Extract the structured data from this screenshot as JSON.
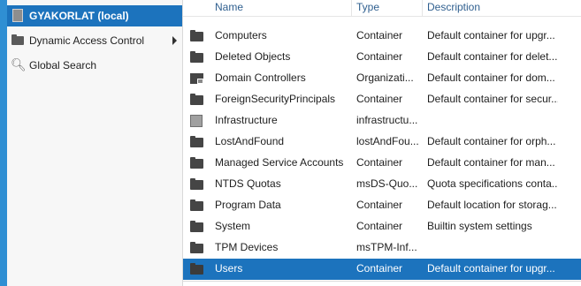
{
  "nav": {
    "items": [
      {
        "label": "GYAKORLAT (local)",
        "icon": "server-icon",
        "selected": true,
        "has_arrow": true
      },
      {
        "label": "Dynamic Access Control",
        "icon": "folder-icon",
        "selected": false,
        "has_arrow": true
      },
      {
        "label": "Global Search",
        "icon": "search-icon",
        "selected": false,
        "has_arrow": false
      }
    ]
  },
  "list": {
    "columns": [
      "Name",
      "Type",
      "Description"
    ],
    "rows": [
      {
        "name": "Computers",
        "type": "Container",
        "description": "Default container for upgr...",
        "icon": "folder-icon"
      },
      {
        "name": "Deleted Objects",
        "type": "Container",
        "description": "Default container for delet...",
        "icon": "folder-icon"
      },
      {
        "name": "Domain Controllers",
        "type": "Organizati...",
        "description": "Default container for dom...",
        "icon": "organizational-unit-icon"
      },
      {
        "name": "ForeignSecurityPrincipals",
        "type": "Container",
        "description": "Default container for secur...",
        "icon": "folder-icon"
      },
      {
        "name": "Infrastructure",
        "type": "infrastructu...",
        "description": "",
        "icon": "infrastructure-icon"
      },
      {
        "name": "LostAndFound",
        "type": "lostAndFou...",
        "description": "Default container for orph...",
        "icon": "folder-icon"
      },
      {
        "name": "Managed Service Accounts",
        "type": "Container",
        "description": "Default container for man...",
        "icon": "folder-icon"
      },
      {
        "name": "NTDS Quotas",
        "type": "msDS-Quo...",
        "description": "Quota specifications conta...",
        "icon": "folder-icon"
      },
      {
        "name": "Program Data",
        "type": "Container",
        "description": "Default location for storag...",
        "icon": "folder-icon"
      },
      {
        "name": "System",
        "type": "Container",
        "description": "Builtin system settings",
        "icon": "folder-icon"
      },
      {
        "name": "TPM Devices",
        "type": "msTPM-Inf...",
        "description": "",
        "icon": "folder-icon"
      },
      {
        "name": "Users",
        "type": "Container",
        "description": "Default container for upgr...",
        "icon": "folder-icon",
        "selected": true
      }
    ]
  },
  "colors": {
    "accent": "#2f8fd3",
    "selection": "#1c73bd",
    "header_text": "#2f5f8f"
  }
}
